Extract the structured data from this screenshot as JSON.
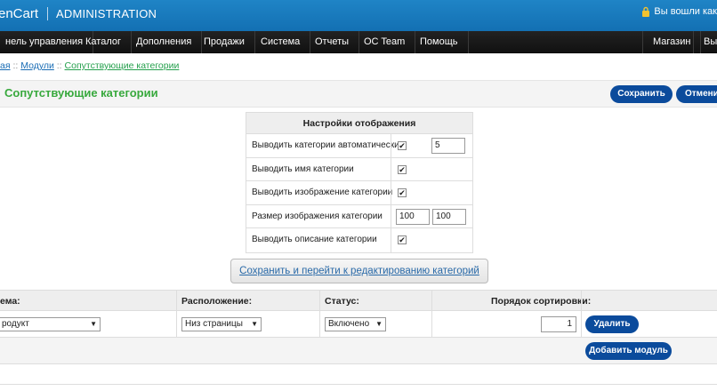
{
  "header": {
    "brand": "enCart",
    "subtitle": "ADMINISTRATION",
    "login_text": "Вы вошли как"
  },
  "menu": {
    "items": [
      "нель управления",
      "Каталог",
      "Дополнения",
      "Продажи",
      "Система",
      "Отчеты",
      "OC Team",
      "Помощь"
    ],
    "right_items": [
      "Магазин",
      "Вых"
    ]
  },
  "breadcrumb": {
    "home": "ая",
    "sep": "::",
    "modules": "Модули",
    "current": "Сопутствующие категории"
  },
  "page": {
    "title": "Сопутствующие категории",
    "save_label": "Сохранить",
    "cancel_label": "Отменить"
  },
  "settings": {
    "header": "Настройки отображения",
    "rows": [
      {
        "label": "Выводить категории автоматически",
        "checked": true,
        "value": "5"
      },
      {
        "label": "Выводить имя категории",
        "checked": true
      },
      {
        "label": "Выводить изображение категории",
        "checked": true
      },
      {
        "label": "Размер изображения категории",
        "width": "100",
        "height": "100"
      },
      {
        "label": "Выводить описание категории",
        "checked": true
      }
    ]
  },
  "edit_button_label": "Сохранить и перейти к редактированию категорий",
  "modules": {
    "columns": [
      "ема:",
      "Расположение:",
      "Статус:",
      "Порядок сортировки:"
    ],
    "row": {
      "layout": "родукт",
      "position": "Низ страницы",
      "status": "Включено",
      "sort_order": "1",
      "remove_label": "Удалить"
    },
    "add_label": "Добавить модуль"
  },
  "colors": {
    "header_blue": "#1a7cc0",
    "button_blue": "#0b4b9c",
    "heading_green": "#38a93d"
  }
}
